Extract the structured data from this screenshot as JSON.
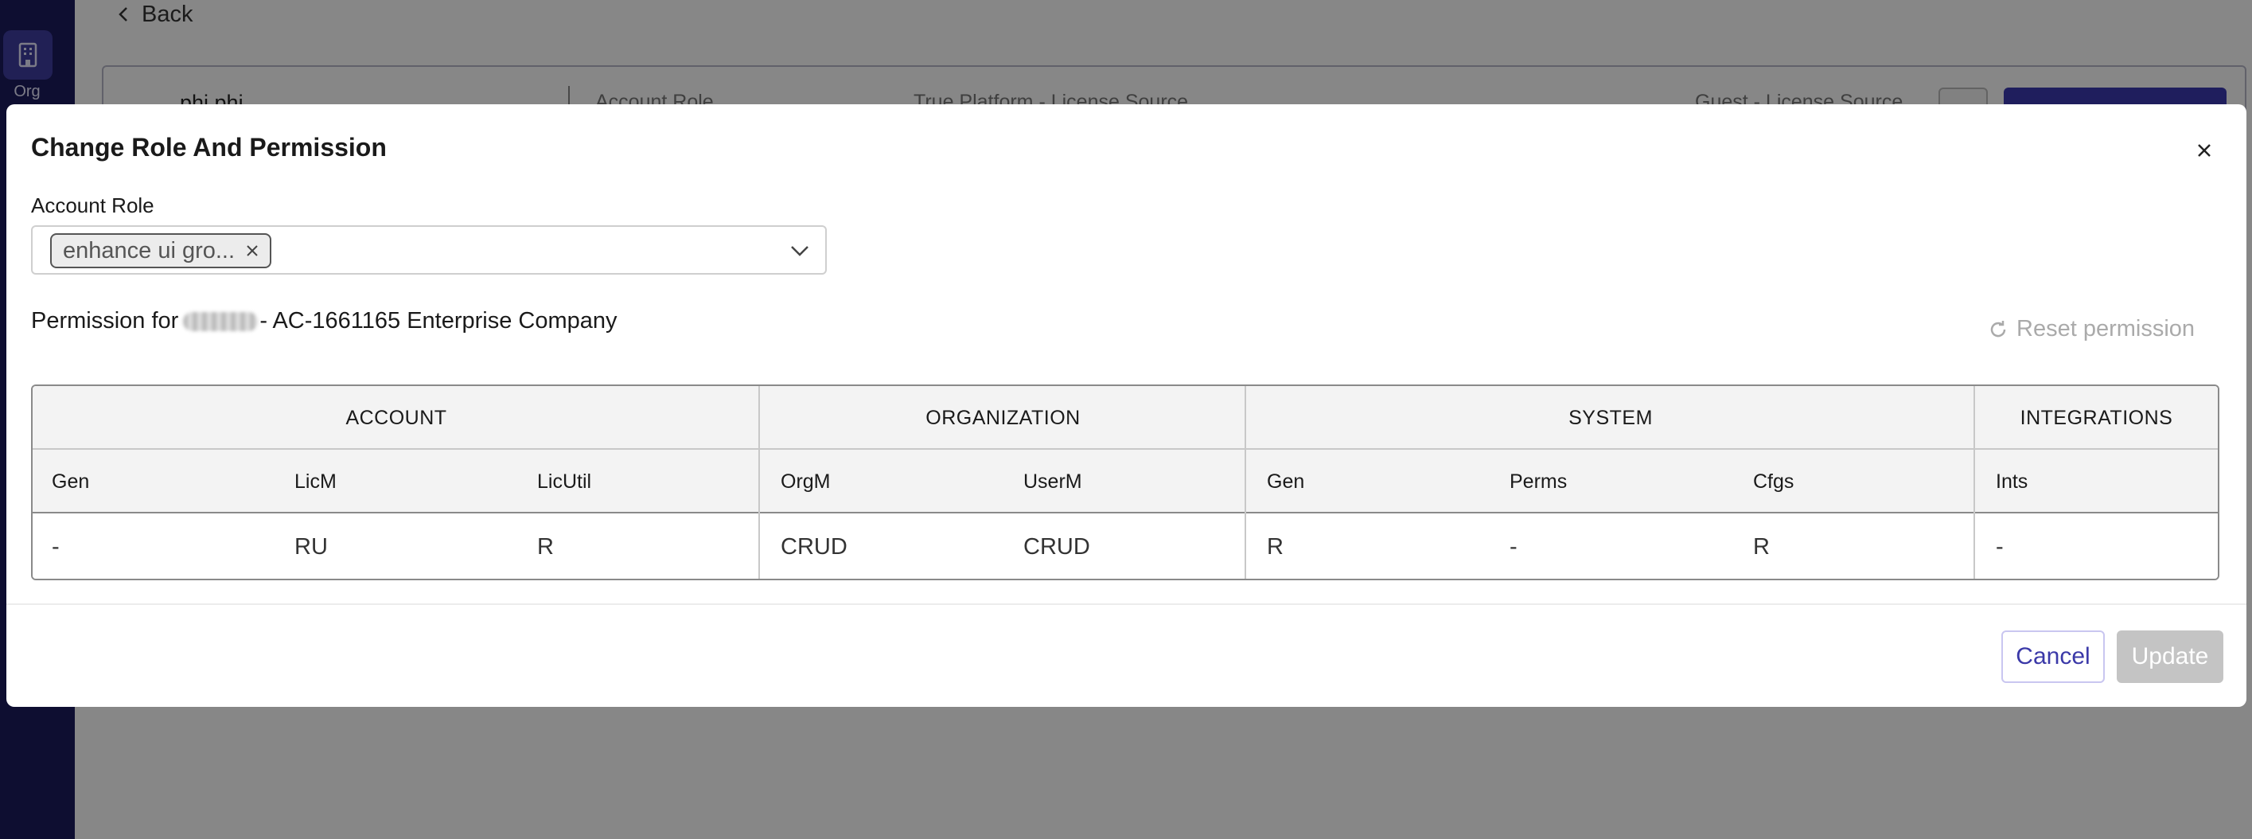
{
  "sidebar": {
    "items": [
      {
        "label": "Org",
        "icon": "building-icon"
      }
    ]
  },
  "background": {
    "back_label": "Back",
    "card": {
      "name": "phi phi",
      "col_account_role": "Account Role",
      "col_license_source": "True Platform - License Source",
      "col_guest_source": "Guest - License Source"
    }
  },
  "modal": {
    "title": "Change Role And Permission",
    "account_role_label": "Account Role",
    "selected_role_chip": "enhance ui gro...",
    "permission_title_prefix": "Permission for",
    "permission_title_suffix": "- AC-1661165 Enterprise Company",
    "reset_label": "Reset permission",
    "table": {
      "groups": [
        "ACCOUNT",
        "ORGANIZATION",
        "SYSTEM",
        "INTEGRATIONS"
      ],
      "columns": [
        "Gen",
        "LicM",
        "LicUtil",
        "OrgM",
        "UserM",
        "Gen",
        "Perms",
        "Cfgs",
        "Ints"
      ],
      "values": [
        "-",
        "RU",
        "R",
        "CRUD",
        "CRUD",
        "R",
        "-",
        "R",
        "-"
      ]
    },
    "cancel_label": "Cancel",
    "update_label": "Update"
  },
  "colors": {
    "sidebar_bg": "#1c1b5e",
    "accent": "#3b39a8",
    "disabled_button": "#c4c4c4"
  }
}
